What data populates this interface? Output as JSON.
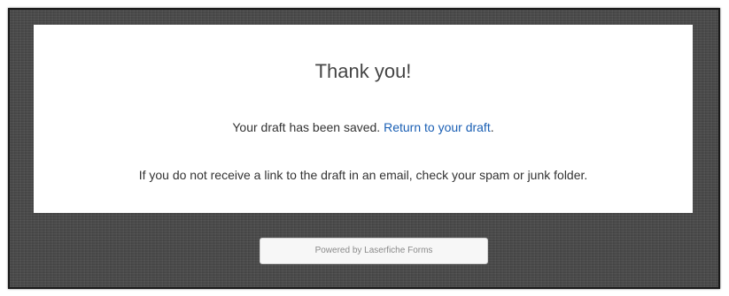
{
  "card": {
    "title": "Thank you!",
    "saved_text": "Your draft has been saved.",
    "return_link": "Return to your draft",
    "period": ".",
    "notice": "If you do not receive a link to the draft in an email, check your spam or junk folder."
  },
  "footer": {
    "powered_by": "Powered by Laserfiche Forms"
  },
  "colors": {
    "background": "#4a4a4a",
    "link": "#1a5fb4",
    "card": "#ffffff"
  }
}
